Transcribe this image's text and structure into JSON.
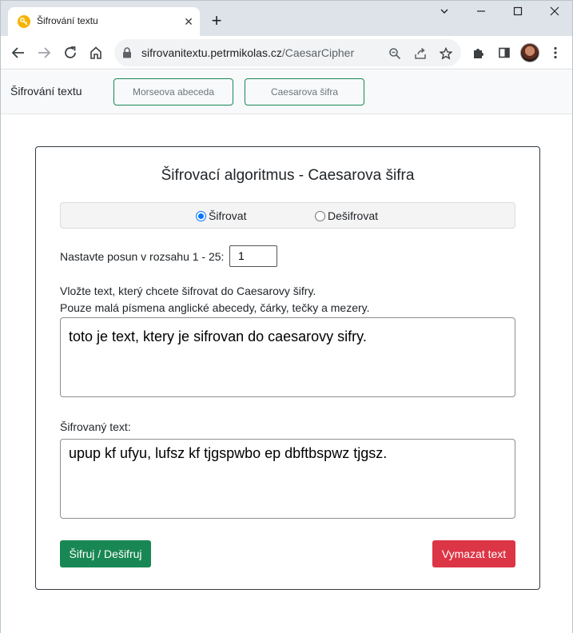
{
  "browser": {
    "tab_title": "Šifrování textu",
    "url_host": "sifrovanitextu.petrmikolas.cz",
    "url_path": "/CaesarCipher"
  },
  "navbar": {
    "brand": "Šifrování textu",
    "links": [
      "Morseova abeceda",
      "Caesarova šifra"
    ]
  },
  "card": {
    "title": "Šifrovací algoritmus - Caesarova šifra",
    "radio_encrypt": "Šifrovat",
    "radio_decrypt": "Dešifrovat",
    "selected_mode": "Šifrovat",
    "shift_label": "Nastavte posun v rozsahu 1 - 25:",
    "shift_value": "1",
    "hint_line1": "Vložte text, který chcete šifrovat do Caesarovy šifry.",
    "hint_line2": "Pouze malá písmena anglické abecedy, čárky, tečky a mezery.",
    "input_text": "toto je text, ktery je sifrovan do caesarovy sifry.",
    "output_label": "Šifrovaný text:",
    "output_text": "upup kf ufyu, lufsz kf tjgspwbo ep dbftbspwz tjgsz.",
    "btn_encrypt": "Šifruj / Dešifruj",
    "btn_clear": "Vymazat text"
  }
}
